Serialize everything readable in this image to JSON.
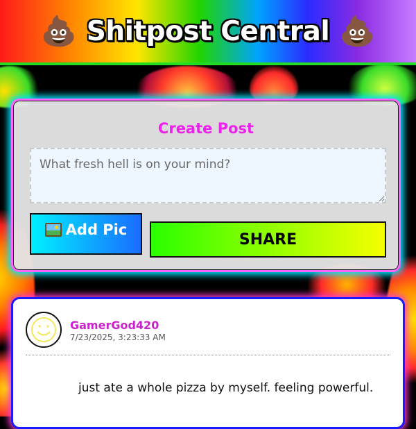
{
  "header": {
    "title": "Shitpost Central",
    "left_icon": "pile-of-poo-icon",
    "right_icon": "pile-of-poo-icon",
    "emoji": "💩"
  },
  "create_post": {
    "title": "Create Post",
    "input_placeholder": "What fresh hell is on your mind?",
    "input_value": "",
    "add_pic_label": "Add Pic",
    "add_pic_icon": "framed-picture-icon",
    "share_label": "SHARE"
  },
  "posts": [
    {
      "author": "GamerGod420",
      "timestamp": "7/23/2025, 3:23:33 AM",
      "avatar_icon": "smiley-face-icon",
      "text": "just ate a whole pizza by myself. feeling powerful."
    }
  ],
  "colors": {
    "title_accent": "#ee22ee",
    "author_accent": "#cc22cc",
    "card_border": "#ff66ff",
    "card_glow": "#00e5ff",
    "post_border": "#1a1aff",
    "share_gradient": [
      "#2bff00",
      "#f5ff00"
    ],
    "add_pic_gradient": [
      "#00f0ff",
      "#1a6dff"
    ]
  }
}
